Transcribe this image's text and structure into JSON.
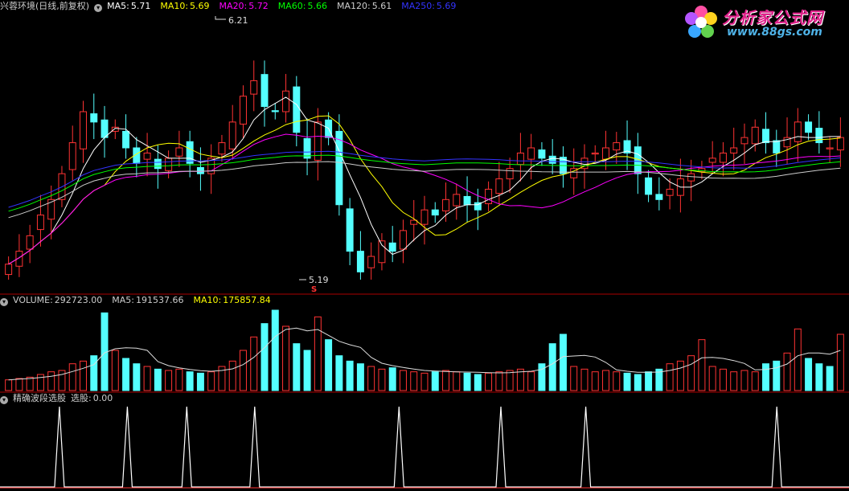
{
  "main_panel": {
    "stock_name": "兴蓉环境(日线,前复权)",
    "indicators": [
      {
        "label": "MA5:",
        "value": "5.71",
        "color": "#ffffff"
      },
      {
        "label": "MA10:",
        "value": "5.69",
        "color": "#ffff00"
      },
      {
        "label": "MA20:",
        "value": "5.72",
        "color": "#ff00ff"
      },
      {
        "label": "MA60:",
        "value": "5.66",
        "color": "#00ff00"
      },
      {
        "label": "MA120:",
        "value": "5.61",
        "color": "#cccccc"
      },
      {
        "label": "MA250:",
        "value": "5.69",
        "color": "#3333ff"
      }
    ],
    "high_label": "6.21",
    "low_label": "5.19",
    "signal_marker": "S"
  },
  "volume_panel": {
    "indicators": [
      {
        "label": "VOLUME:",
        "value": "292723.00",
        "color": "#cccccc"
      },
      {
        "label": "MA5:",
        "value": "191537.66",
        "color": "#cccccc"
      },
      {
        "label": "MA10:",
        "value": "175857.84",
        "color": "#ffff00"
      }
    ]
  },
  "signal_panel": {
    "name": "精确波段选股",
    "indicators": [
      {
        "label": "选股:",
        "value": "0.00",
        "color": "#cccccc"
      }
    ]
  },
  "logo": {
    "title": "分析家公式网",
    "url": "www.88gs.com"
  },
  "colors": {
    "up": "#ff3333",
    "down": "#54ffff",
    "separator": "#aa0000"
  },
  "chart_data": [
    {
      "type": "candlestick",
      "title": "兴蓉环境(日线,前复权)",
      "y_range": [
        5.19,
        6.21
      ],
      "highest": 6.21,
      "lowest": 5.19,
      "series": [
        {
          "name": "MA5",
          "last": 5.71
        },
        {
          "name": "MA10",
          "last": 5.69
        },
        {
          "name": "MA20",
          "last": 5.72
        },
        {
          "name": "MA60",
          "last": 5.66
        },
        {
          "name": "MA120",
          "last": 5.61
        },
        {
          "name": "MA250",
          "last": 5.69
        }
      ],
      "closes": [
        5.25,
        5.3,
        5.36,
        5.44,
        5.5,
        5.6,
        5.72,
        5.84,
        5.8,
        5.74,
        5.78,
        5.7,
        5.64,
        5.68,
        5.62,
        5.66,
        5.7,
        5.64,
        5.6,
        5.66,
        5.72,
        5.8,
        5.9,
        5.96,
        5.86,
        5.84,
        5.92,
        5.76,
        5.66,
        5.8,
        5.74,
        5.48,
        5.3,
        5.22,
        5.28,
        5.34,
        5.3,
        5.38,
        5.42,
        5.46,
        5.44,
        5.5,
        5.52,
        5.48,
        5.46,
        5.54,
        5.58,
        5.62,
        5.68,
        5.7,
        5.66,
        5.64,
        5.6,
        5.62,
        5.66,
        5.68,
        5.7,
        5.72,
        5.68,
        5.6,
        5.52,
        5.5,
        5.54,
        5.58,
        5.6,
        5.62,
        5.66,
        5.68,
        5.7,
        5.74,
        5.78,
        5.72,
        5.68,
        5.74,
        5.8,
        5.76,
        5.72,
        5.7,
        5.74
      ]
    },
    {
      "type": "bar",
      "title": "VOLUME",
      "series": [
        {
          "name": "VOLUME",
          "last": 292723.0
        },
        {
          "name": "MA5",
          "last": 191537.66
        },
        {
          "name": "MA10",
          "last": 175857.84
        }
      ],
      "values": [
        8,
        9,
        10,
        12,
        14,
        15,
        20,
        22,
        26,
        58,
        30,
        24,
        20,
        18,
        16,
        15,
        16,
        14,
        13,
        14,
        18,
        22,
        30,
        40,
        50,
        60,
        48,
        35,
        30,
        55,
        38,
        26,
        22,
        20,
        18,
        16,
        17,
        15,
        14,
        13,
        14,
        15,
        14,
        13,
        12,
        13,
        14,
        15,
        16,
        14,
        20,
        35,
        42,
        18,
        16,
        14,
        15,
        14,
        13,
        12,
        14,
        16,
        20,
        22,
        26,
        38,
        18,
        16,
        14,
        15,
        14,
        20,
        22,
        28,
        46,
        24,
        20,
        18,
        42
      ]
    },
    {
      "type": "line",
      "title": "精确波段选股",
      "series": [
        {
          "name": "选股",
          "last": 0.0
        }
      ],
      "signal_x": [
        0.07,
        0.15,
        0.22,
        0.3,
        0.47,
        0.59,
        0.69,
        0.915
      ]
    }
  ]
}
